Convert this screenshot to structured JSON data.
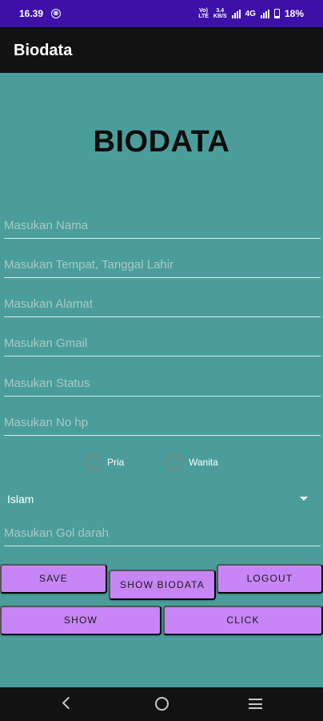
{
  "status_bar": {
    "time": "16.39",
    "notification_glyph": "⊗",
    "network_top": "Vo)",
    "network_bottom": "LTE",
    "data_top": "3.4",
    "data_bottom": "KB/S",
    "network_type": "4G",
    "battery_percent": "18%"
  },
  "app_bar": {
    "title": "Biodata"
  },
  "main": {
    "heading": "BIODATA",
    "fields": {
      "nama": "Masukan Nama",
      "ttl": "Masukan Tempat, Tanggal Lahir",
      "alamat": "Masukan Alamat",
      "gmail": "Masukan Gmail",
      "status": "Masukan Status",
      "nohp": "Masukan No hp",
      "goldarah": "Masukan Gol darah"
    },
    "gender": {
      "pria": "Pria",
      "wanita": "Wanita"
    },
    "religion": {
      "selected": "Islam"
    },
    "buttons": {
      "save": "SAVE",
      "show_biodata": "SHOW BIODATA",
      "logout": "LOGOUT",
      "show": "SHOW",
      "click": "CLICK"
    }
  },
  "colors": {
    "background": "#4a9d9a",
    "status_bar": "#3d10a8",
    "app_bar": "#121212",
    "button": "#c785f5"
  }
}
